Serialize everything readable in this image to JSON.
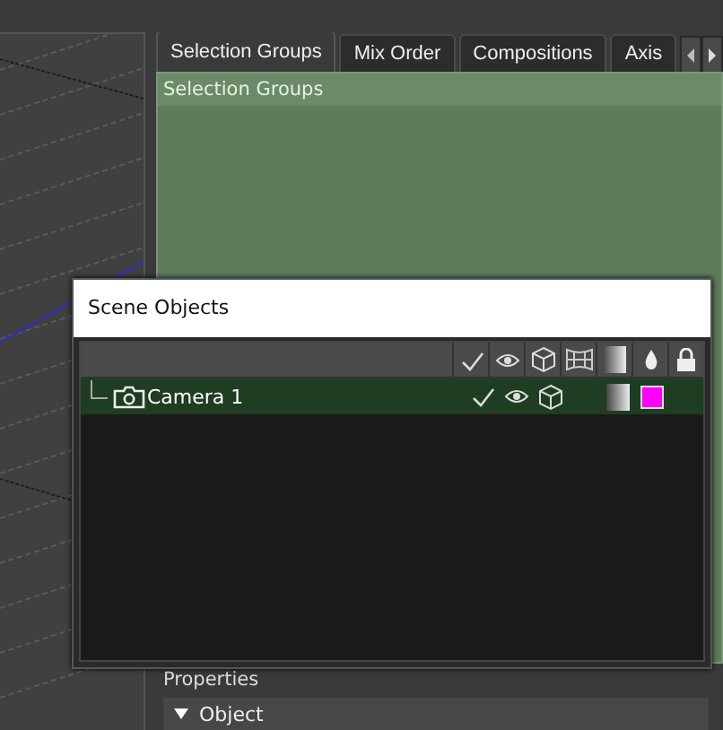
{
  "tabs": [
    {
      "label": "Selection Groups",
      "selected": true
    },
    {
      "label": "Mix Order",
      "selected": false
    },
    {
      "label": "Compositions",
      "selected": false
    },
    {
      "label": "Axis",
      "selected": false
    }
  ],
  "selection_groups": {
    "title": "Selection Groups"
  },
  "properties": {
    "title": "Properties",
    "section": {
      "label": "Object",
      "expanded": true
    }
  },
  "scene_objects": {
    "title": "Scene Objects",
    "rows": [
      {
        "name": "Camera 1",
        "selected": true,
        "enabled": true,
        "visible": true,
        "color": "#ff00ff"
      }
    ]
  }
}
